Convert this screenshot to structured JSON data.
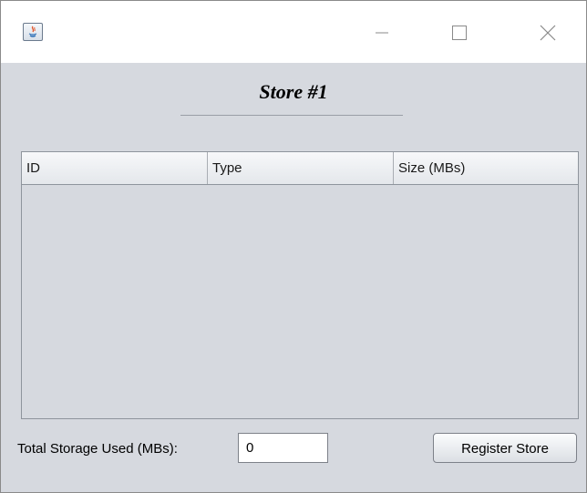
{
  "window": {
    "title": "",
    "icon": "java-app-icon",
    "controls": [
      "minimize-icon",
      "maximize-icon",
      "close-icon"
    ]
  },
  "heading": "Store #1",
  "table": {
    "columns": [
      "ID",
      "Type",
      "Size (MBs)"
    ],
    "rows": []
  },
  "footer": {
    "total_label": "Total Storage Used (MBs):",
    "total_value": "0",
    "register_button": "Register Store"
  },
  "colors": {
    "window_bg": "#d6d9df",
    "titlebar_bg": "#ffffff",
    "border": "#8e949c"
  }
}
